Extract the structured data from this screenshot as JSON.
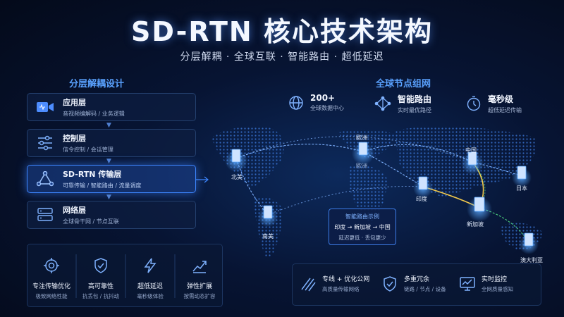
{
  "header": {
    "title": "SD-RTN 核心技术架构",
    "subtitle": "分层解耦 · 全球互联 · 智能路由 · 超低延迟"
  },
  "left": {
    "section_title": "分层解耦设计",
    "layers": [
      {
        "name": "应用层",
        "desc": "音视频编解码 / 业务逻辑",
        "icon": "video-camera-icon",
        "active": false
      },
      {
        "name": "控制层",
        "desc": "信令控制 / 会话管理",
        "icon": "sliders-icon",
        "active": false
      },
      {
        "name": "SD-RTN 传输层",
        "desc": "可靠传输 / 智能路由 / 流量调度",
        "icon": "network-triangle-icon",
        "active": true
      },
      {
        "name": "网络层",
        "desc": "全球骨干网 / 节点互联",
        "icon": "server-icon",
        "active": false
      }
    ],
    "features": [
      {
        "name": "专注传输优化",
        "desc": "极致网络性能",
        "icon": "target-icon"
      },
      {
        "name": "高可靠性",
        "desc": "抗丢包 / 抗抖动",
        "icon": "shield-check-icon"
      },
      {
        "name": "超低延迟",
        "desc": "毫秒级体验",
        "icon": "lightning-icon"
      },
      {
        "name": "弹性扩展",
        "desc": "按需动态扩容",
        "icon": "trend-up-icon"
      }
    ]
  },
  "right": {
    "section_title": "全球节点组网",
    "stats": [
      {
        "value": "200+",
        "desc": "全球数据中心",
        "icon": "globe-icon"
      },
      {
        "value": "智能路由",
        "desc": "实时最优路径",
        "icon": "routing-network-icon"
      },
      {
        "value": "毫秒级",
        "desc": "超低延迟传输",
        "icon": "stopwatch-icon"
      }
    ],
    "nodes": {
      "north_america": "北美",
      "europe": "欧洲",
      "china": "中国",
      "japan": "日本",
      "india": "印度",
      "singapore": "新加坡",
      "south_america": "南美",
      "australia": "澳大利亚"
    },
    "callout": {
      "title": "智能路由示例",
      "route_from": "印度",
      "route_mid": "新加坡",
      "route_to": "中国",
      "note": "延迟更低 · 丢包更少"
    },
    "bottom_features": [
      {
        "name": "专线 + 优化公网",
        "desc": "高质量传输网络",
        "icon": "lines-icon"
      },
      {
        "name": "多重冗余",
        "desc": "链路 / 节点 / 设备",
        "icon": "shield-check-icon"
      },
      {
        "name": "实时监控",
        "desc": "全网质量感知",
        "icon": "monitor-chart-icon"
      }
    ]
  },
  "colors": {
    "accent": "#3d86ff",
    "route": "#f2c94c",
    "link": "#7fb2ff",
    "green": "#4cd07d"
  }
}
